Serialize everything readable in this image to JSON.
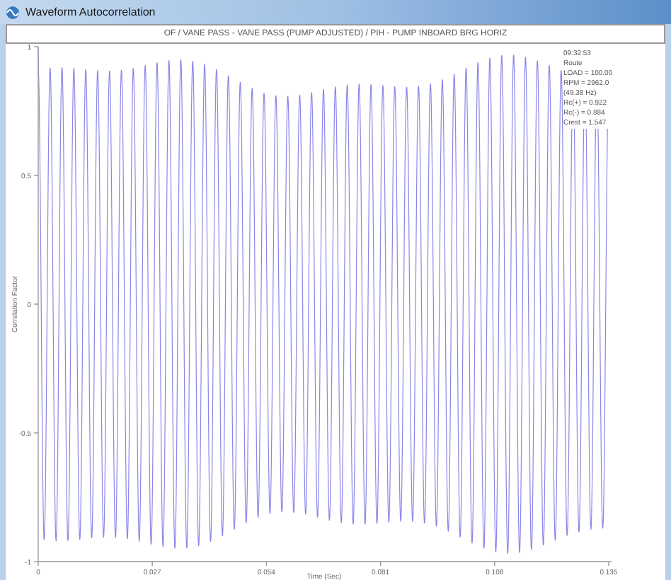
{
  "window": {
    "title": "Waveform Autocorrelation"
  },
  "plot": {
    "title": "OF / VANE PASS - VANE PASS (PUMP ADJUSTED) / PIH - PUMP INBOARD BRG HORIZ",
    "info_lines": [
      "09:32:53",
      "Route",
      "LOAD = 100.00",
      "RPM = 2962.0",
      "(49.38 Hz)",
      "Rc(+) = 0.922",
      "Rc(-) = 0.884",
      "Crest = 1.547"
    ],
    "y_axis": {
      "label": "Correlation Factor",
      "ticks": [
        "1",
        "0.5",
        "0",
        "-0.5",
        "-1"
      ]
    },
    "x_axis": {
      "label": "Time (Sec)",
      "ticks": [
        "0",
        "0.027",
        "0.054",
        "0.081",
        "0.108",
        "0.135"
      ]
    }
  }
}
